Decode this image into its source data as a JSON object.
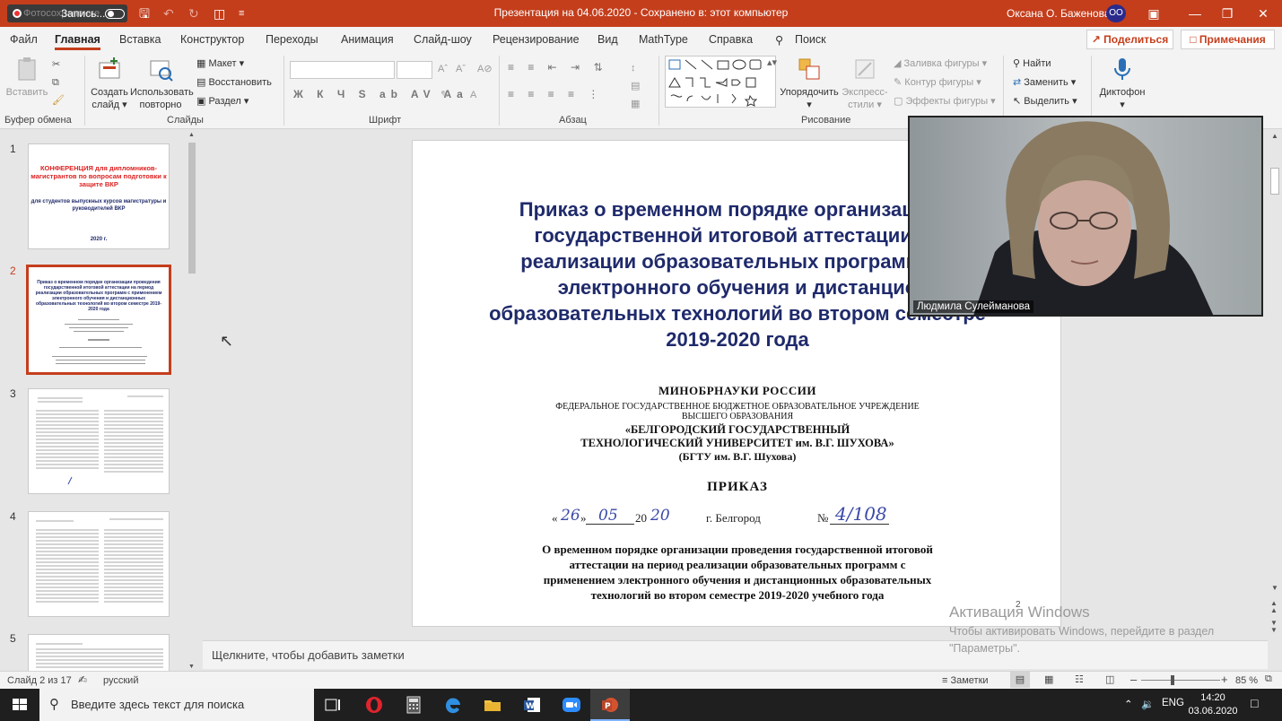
{
  "titlebar": {
    "recording_brand": "Фотосохранение",
    "recording_label": "Запись...",
    "document_title": "Презентация на 04.06.2020 - Сохранено в: этот компьютер",
    "user_name": "Оксана О. Баженова",
    "user_initials": "ОО",
    "accent_color": "#c43e1c"
  },
  "tabs": [
    "Файл",
    "Главная",
    "Вставка",
    "Конструктор",
    "Переходы",
    "Анимация",
    "Слайд-шоу",
    "Рецензирование",
    "Вид",
    "MathType",
    "Справка",
    "Поиск"
  ],
  "share_label": "Поделиться",
  "comments_label": "Примечания",
  "ribbon": {
    "clipboard": {
      "paste": "Вставить",
      "group": "Буфер обмена"
    },
    "slides": {
      "new_slide_1": "Создать",
      "new_slide_2": "слайд",
      "reuse_1": "Использовать",
      "reuse_2": "повторно",
      "layout": "Макет",
      "reset": "Восстановить",
      "section": "Раздел",
      "group": "Слайды"
    },
    "font": {
      "group": "Шрифт",
      "format_row": "Ж К Ч S ab AV Aa"
    },
    "paragraph": {
      "group": "Абзац"
    },
    "drawing": {
      "arrange": "Упорядочить",
      "quick_styles_1": "Экспресс-",
      "quick_styles_2": "стили",
      "shape_fill": "Заливка фигуры",
      "shape_outline": "Контур фигуры",
      "shape_effects": "Эффекты фигуры",
      "group": "Рисование"
    },
    "editing": {
      "find": "Найти",
      "replace": "Заменить",
      "select": "Выделить"
    },
    "voice": {
      "dictate": "Диктофон"
    }
  },
  "thumbnails": {
    "numbers": [
      "1",
      "2",
      "3",
      "4",
      "5"
    ],
    "slide1": {
      "title": "КОНФЕРЕНЦИЯ для дипломников-магистрантов по вопросам подготовки к защите ВКР",
      "subtitle": "для студентов выпускных курсов магистратуры и руководителей ВКР",
      "year": "2020 г."
    },
    "slide2": {
      "title": "Приказ о временном порядке организации проведения государственной итоговой аттестации на период реализации образовательных программ с применением электронного обучения и дистанционных образовательных технологий во втором семестре 2019-2020 года"
    }
  },
  "slide": {
    "title": "Приказ о временном порядке организации п... государственной итоговой аттестации на... реализации образовательных программ с п... электронного обучения и дистанцио... образовательных технологий во втором семестре 2019-2020 года",
    "title_lines": [
      "Приказ о временном порядке организации п",
      "государственной итоговой аттестации на",
      "реализации образовательных программ с п",
      "электронного обучения и дистанцио",
      "образовательных технологий во втором семестре",
      "2019-2020 года"
    ],
    "ministry": "МИНОБРНАУКИ РОССИИ",
    "institution_line1": "ФЕДЕРАЛЬНОЕ ГОСУДАРСТВЕННОЕ БЮДЖЕТНОЕ ОБРАЗОВАТЕЛЬНОЕ УЧРЕЖДЕНИЕ",
    "institution_line2": "ВЫСШЕГО ОБРАЗОВАНИЯ",
    "institution_line3": "«БЕЛГОРОДСКИЙ ГОСУДАРСТВЕННЫЙ",
    "institution_line4": "ТЕХНОЛОГИЧЕСКИЙ УНИВЕРСИТЕТ им. В.Г. ШУХОВА»",
    "institution_line5": "(БГТУ им. В.Г. Шухова)",
    "order_word": "ПРИКАЗ",
    "date_day": "26",
    "date_month": "05",
    "date_year_prefix": "20",
    "date_year": "20",
    "city": "г. Белгород",
    "number_prefix": "№",
    "number": "4/108",
    "subject_lines": [
      "О временном порядке организации проведения государственной итоговой",
      "аттестации на период реализации образовательных программ с",
      "применением электронного обучения и дистанционных образовательных",
      "технологий во втором семестре 2019-2020 учебного года"
    ],
    "page_number": "2"
  },
  "video": {
    "participant_name": "Людмила Сулейманова"
  },
  "notes_placeholder": "Щелкните, чтобы добавить заметки",
  "activation": {
    "title": "Активация Windows",
    "line1": "Чтобы активировать Windows, перейдите в раздел",
    "line2": "\"Параметры\"."
  },
  "statusbar": {
    "slide_counter": "Слайд 2 из 17",
    "language": "русский",
    "notes": "Заметки",
    "zoom": "85 %"
  },
  "taskbar": {
    "search_placeholder": "Введите здесь текст для поиска",
    "language": "ENG",
    "time": "14:20",
    "date": "03.06.2020"
  }
}
